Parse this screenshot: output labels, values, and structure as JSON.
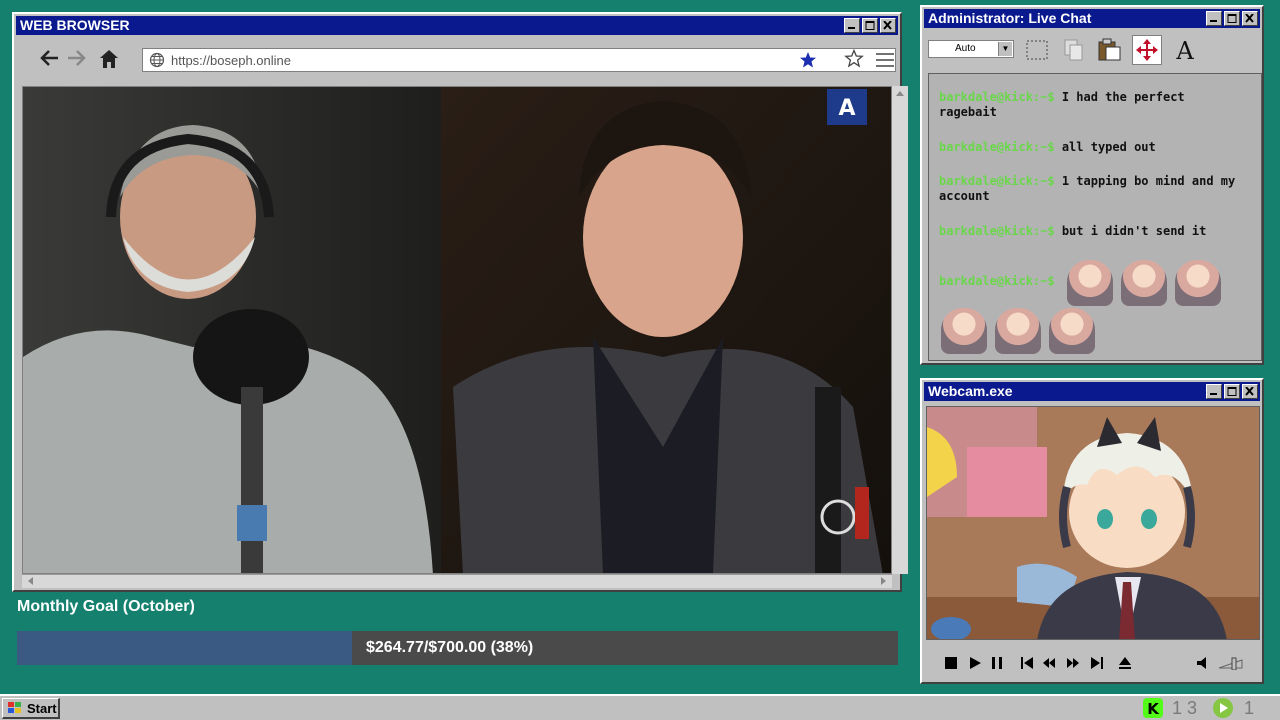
{
  "browser": {
    "title": "WEB BROWSER",
    "url": "https://boseph.online"
  },
  "chat": {
    "title": "Administrator: Live Chat",
    "font_select": "Auto",
    "messages": [
      {
        "user": "barkdale@kick:~$",
        "text": "I had the perfect ragebait"
      },
      {
        "user": "barkdale@kick:~$",
        "text": "all typed out"
      },
      {
        "user": "barkdale@kick:~$",
        "text": "1 tapping bo mind and my account"
      },
      {
        "user": "barkdale@kick:~$",
        "text": "but i didn't send it"
      },
      {
        "user": "barkdale@kick:~$",
        "text": ""
      }
    ]
  },
  "webcam": {
    "title": "Webcam.exe"
  },
  "goal": {
    "title": "Monthly Goal (October)",
    "text": "$264.77/$700.00 (38%)",
    "progress": 0.38
  },
  "taskbar": {
    "start_label": "Start",
    "kick_count": "1 3",
    "rumble_count": "1"
  },
  "colors": {
    "desktop": "#16806f",
    "titlebar": "#0a1a8e",
    "goal_fill": "#3b5a83",
    "chat_user": "#6ad74a"
  }
}
